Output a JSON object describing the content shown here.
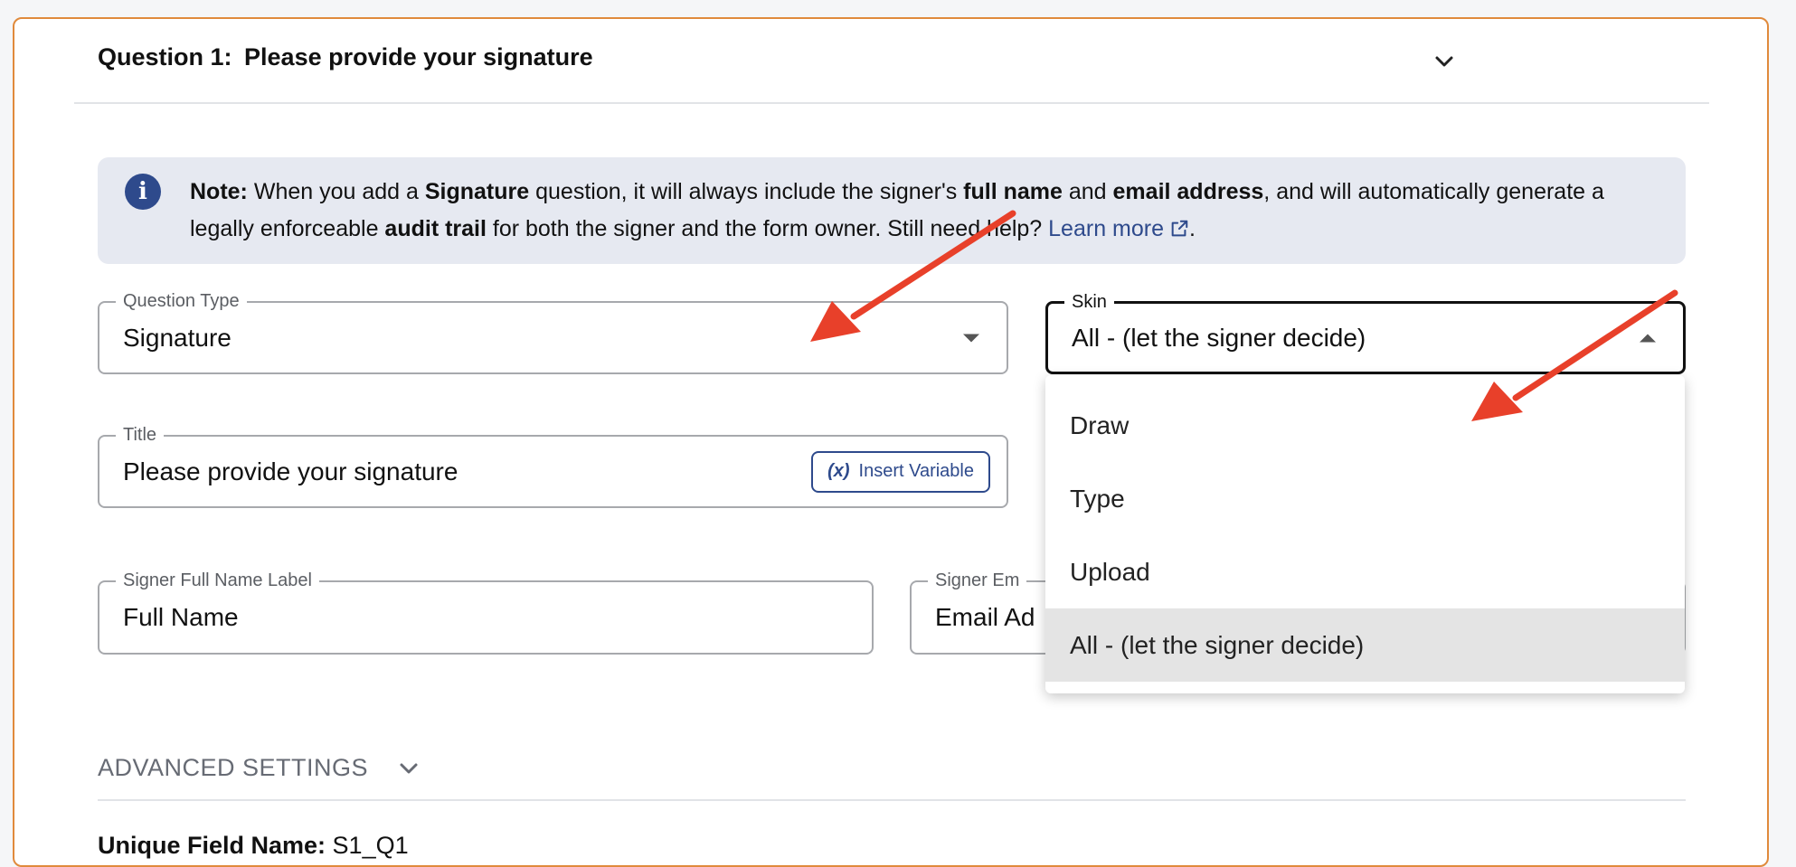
{
  "question": {
    "number_label": "Question 1:",
    "title": "Please provide your signature"
  },
  "note": {
    "lead": "Note:",
    "t1": "When you add a ",
    "b1": "Signature",
    "t2": " question, it will always include the signer's ",
    "b2": "full name",
    "t3": " and ",
    "b3": "email address",
    "t4": ", and will automatically generate a legally enforceable ",
    "b4": "audit trail",
    "t5": " for both the signer and the form owner. Still need help? ",
    "link": "Learn more",
    "t6": "."
  },
  "question_type": {
    "label": "Question Type",
    "value": "Signature"
  },
  "skin": {
    "label": "Skin",
    "value": "All - (let the signer decide)",
    "options": [
      "Draw",
      "Type",
      "Upload",
      "All - (let the signer decide)"
    ],
    "selected_index": 3
  },
  "title_field": {
    "label": "Title",
    "value": "Please provide your signature",
    "insert_variable_icon": "(x)",
    "insert_variable_label": "Insert Variable"
  },
  "signer_name": {
    "label": "Signer Full Name Label",
    "value": "Full Name"
  },
  "signer_email": {
    "label": "Signer Em",
    "value": "Email Ad"
  },
  "advanced": {
    "label": "ADVANCED SETTINGS"
  },
  "unique_field": {
    "label": "Unique Field Name:",
    "value": "S1_Q1"
  },
  "colors": {
    "card_border": "#e08a3c",
    "accent": "#2e4a8c",
    "note_bg": "#e6e9f1",
    "annotation_arrow": "#e8402a",
    "selected_option_bg": "#e4e4e4"
  },
  "icons": [
    "chevron-down-icon",
    "info-icon",
    "external-link-icon",
    "caret-down-icon",
    "caret-up-icon",
    "variable-icon",
    "annotation-arrow"
  ]
}
